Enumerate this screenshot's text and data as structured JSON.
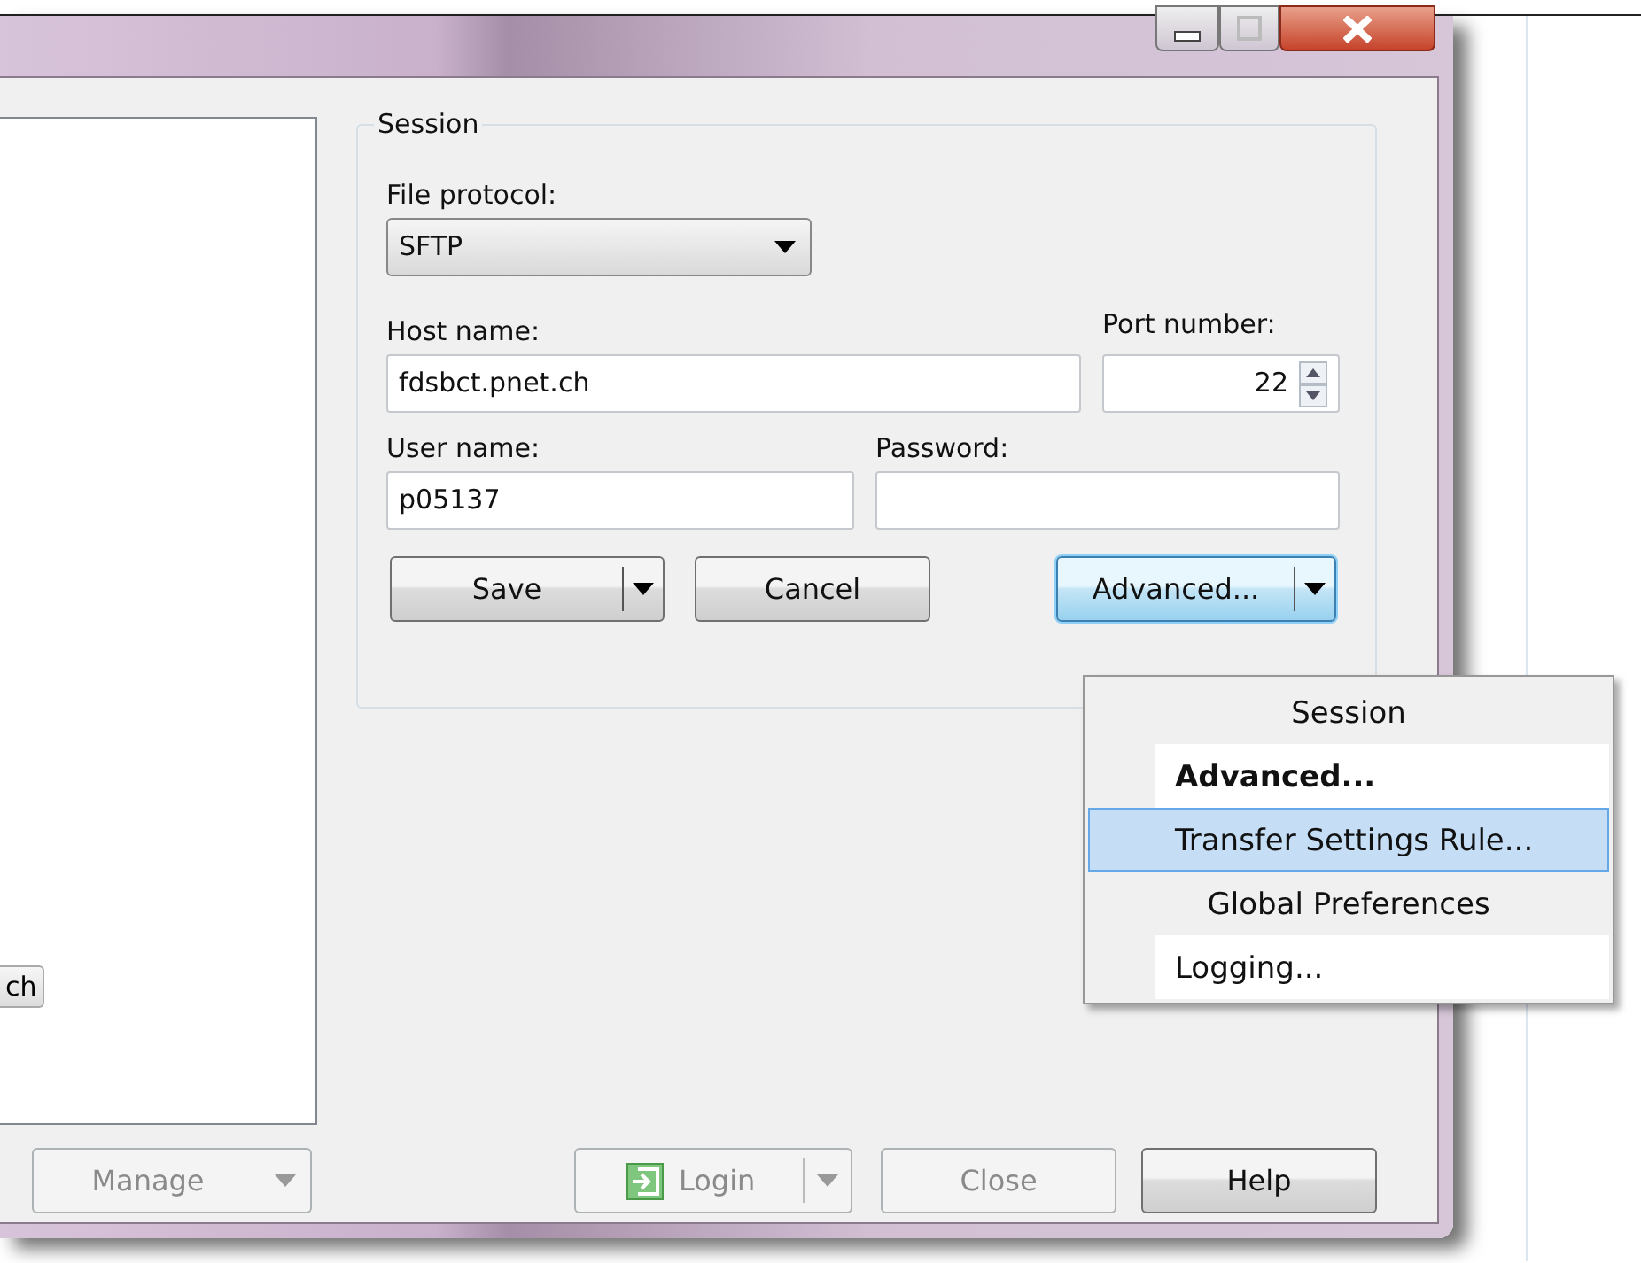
{
  "left_panel": {
    "button": "ch"
  },
  "session": {
    "title": "Session",
    "protocol": {
      "label": "File protocol:",
      "value": "SFTP"
    },
    "host": {
      "label": "Host name:",
      "value": "fdsbct.pnet.ch"
    },
    "port": {
      "label": "Port number:",
      "value": "22"
    },
    "user": {
      "label": "User name:",
      "value": "p05137"
    },
    "password": {
      "label": "Password:"
    },
    "buttons": [
      {
        "label": "Save",
        "split": true,
        "focused": false
      },
      {
        "label": "Cancel",
        "split": false,
        "focused": false
      },
      {
        "label": "Advanced...",
        "split": true,
        "focused": true
      }
    ]
  },
  "menu": [
    {
      "kind": "header",
      "label": "Session",
      "selected": false
    },
    {
      "kind": "item",
      "label": "Advanced...",
      "bold": true,
      "selected": false
    },
    {
      "kind": "item",
      "label": "Transfer Settings Rule...",
      "bold": false,
      "selected": true
    },
    {
      "kind": "header",
      "label": "Global Preferences",
      "selected": false
    },
    {
      "kind": "item",
      "label": "Logging...",
      "bold": false,
      "selected": false
    }
  ],
  "bottom_buttons": [
    {
      "label": "Manage",
      "kind": "dropdown",
      "disabled": true
    },
    {
      "label": "Login",
      "kind": "split",
      "disabled": true
    },
    {
      "label": "Close",
      "kind": "plain",
      "disabled": true
    },
    {
      "label": "Help",
      "kind": "plain",
      "disabled": false
    }
  ]
}
